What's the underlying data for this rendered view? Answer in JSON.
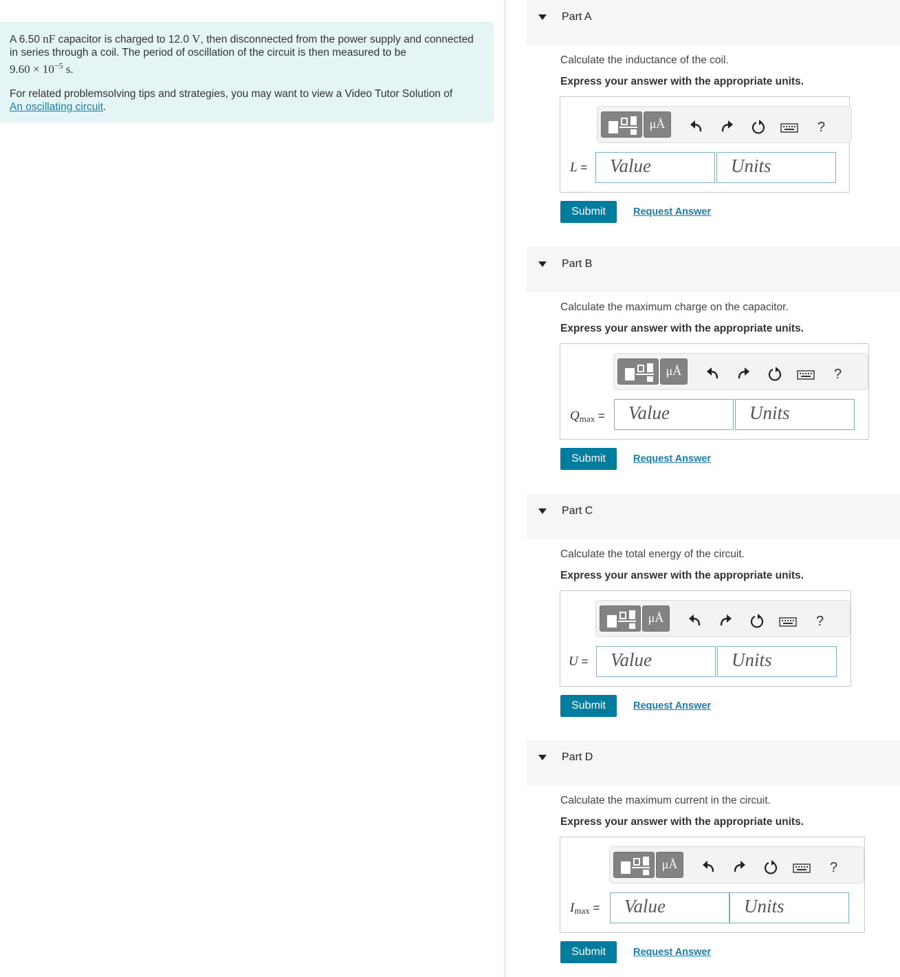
{
  "problem": {
    "text_1": "A 6.50",
    "unit_1": "nF",
    "text_2": "capacitor is charged to 12.0",
    "unit_2": "V",
    "text_3": ", then disconnected from the power supply and connected in series through a coil. The period of oscillation of the circuit is then measured to be",
    "period_mantissa": "9.60 × 10",
    "period_exponent": "−5",
    "period_unit": "s",
    "tips_text": "For related problemsolving tips and strategies, you may want to view a Video Tutor Solution of",
    "tips_link": "An oscillating circuit",
    "tips_end": "."
  },
  "toolbar": {
    "units_glyph": "μÅ",
    "help_glyph": "?",
    "icons": [
      "templates-icon",
      "units-icon",
      "undo-icon",
      "redo-icon",
      "reset-icon",
      "keyboard-icon",
      "help-icon"
    ]
  },
  "common": {
    "instruction": "Express your answer with the appropriate units.",
    "submit_label": "Submit",
    "request_answer_label": "Request Answer",
    "value_placeholder": "Value",
    "units_placeholder": "Units",
    "equals": "="
  },
  "parts": [
    {
      "title": "Part A",
      "question": "Calculate the inductance of the coil.",
      "var": "L",
      "sub": ""
    },
    {
      "title": "Part B",
      "question": "Calculate the maximum charge on the capacitor.",
      "var": "Q",
      "sub": "max"
    },
    {
      "title": "Part C",
      "question": "Calculate the total energy of the circuit.",
      "var": "U",
      "sub": ""
    },
    {
      "title": "Part D",
      "question": "Calculate the maximum current in the circuit.",
      "var": "I",
      "sub": "max"
    }
  ],
  "colors": {
    "accent": "#007c9e",
    "link": "#1a7ea8",
    "problem_bg": "#e5f5f6",
    "field_border": "#7bb2c3"
  }
}
